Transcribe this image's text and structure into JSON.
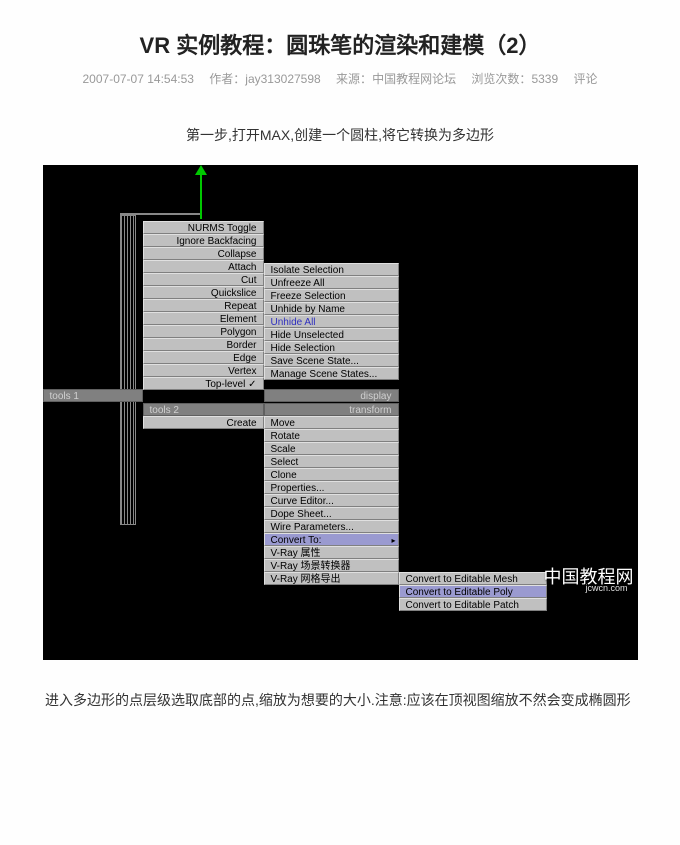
{
  "pageTitle": "VR 实例教程：圆珠笔的渲染和建模（2）",
  "meta": {
    "datetime": "2007-07-07 14:54:53",
    "authorLabel": "作者：",
    "author": "jay313027598",
    "sourceLabel": "来源：",
    "source": "中国教程网论坛",
    "viewsLabel": "浏览次数：",
    "views": "5339",
    "comments": "评论"
  },
  "step1": "第一步,打开MAX,创建一个圆柱,将它转换为多边形",
  "menuFirst": [
    "NURMS Toggle",
    "Ignore Backfacing",
    "Collapse",
    "Attach",
    "Cut",
    "Quickslice",
    "Repeat",
    "Element",
    "Polygon",
    "Border",
    "Edge",
    "Vertex",
    "Top-level ✓"
  ],
  "menuSecond": [
    "Isolate Selection",
    "Unfreeze All",
    "Freeze Selection",
    "Unhide by Name",
    "Unhide All",
    "Hide Unselected",
    "Hide Selection",
    "Save Scene State...",
    "Manage Scene States..."
  ],
  "tools1Header": "tools 1",
  "displayLabel": "display",
  "tools2Header": "tools 2",
  "transformLabel": "transform",
  "tools2": [
    "Create"
  ],
  "menuTransform": [
    "Move",
    "Rotate",
    "Scale",
    "Select",
    "Clone",
    "Properties...",
    "Curve Editor...",
    "Dope Sheet...",
    "Wire Parameters...",
    "Convert To:",
    "V-Ray 属性",
    "V-Ray 场景转换器",
    "V-Ray 网格导出"
  ],
  "menuConvert": [
    "Convert to Editable Mesh",
    "Convert to Editable Poly",
    "Convert to Editable Patch"
  ],
  "watermark": "中国教程网",
  "watermarkSub": "jcwcn.com",
  "bottomText": "进入多边形的点层级选取底部的点,缩放为想要的大小.注意:应该在顶视图缩放不然会变成椭圆形"
}
